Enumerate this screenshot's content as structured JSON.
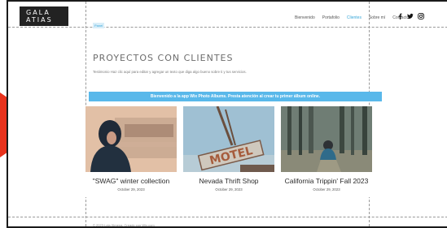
{
  "logo": {
    "line1": "GALA",
    "line2": "ATIAS"
  },
  "nav": {
    "items": [
      "Bienvenido",
      "Portafolio",
      "Clientes",
      "Sobre mí",
      "Contacto"
    ],
    "active_index": 2
  },
  "social": {
    "icons": [
      "facebook-icon",
      "twitter-icon",
      "instagram-icon"
    ]
  },
  "page_chip": "Panel",
  "section": {
    "title": "PROYECTOS CON CLIENTES",
    "text": "Testimonio Haz clic aquí para editar y agregar un texto que diga algo bueno sobre ti y tus servicios."
  },
  "banner": "Bienvenido a la app Wix Photo Albums. Presta atención al crear tu primer álbum online.",
  "cards": [
    {
      "title": "\"SWAG\" winter collection",
      "date": "October 29, 2023"
    },
    {
      "title": "Nevada Thrift Shop",
      "date": "October 29, 2023"
    },
    {
      "title": "California Trippin' Fall 2023",
      "date": "October 29, 2023"
    }
  ],
  "motel_sign": "MOTEL",
  "footer": "© 2023 Lola Ximena. Creado con Wix.com",
  "colors": {
    "accent": "#3aa7d9",
    "banner": "#59b8ea",
    "arrow": "#e8321c",
    "logo_bg": "#222222"
  }
}
